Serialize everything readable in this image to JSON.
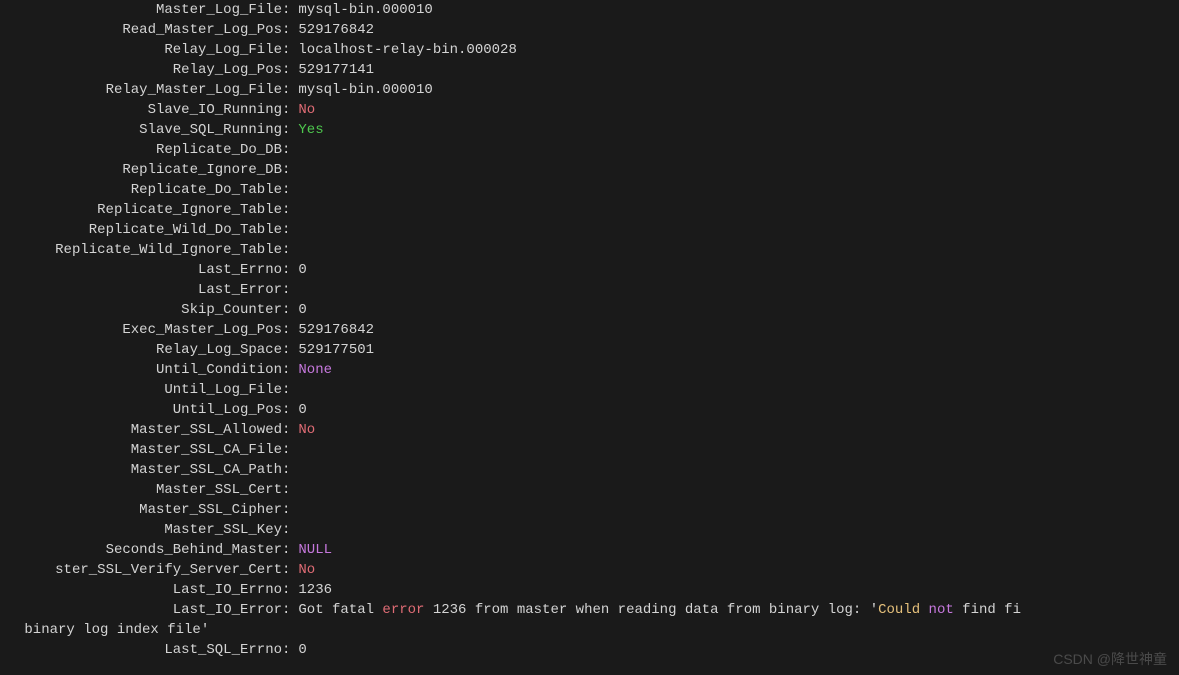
{
  "rows": [
    {
      "label": "Master_Log_File",
      "value": "mysql-bin.000010",
      "cls": ""
    },
    {
      "label": "Read_Master_Log_Pos",
      "value": "529176842",
      "cls": ""
    },
    {
      "label": "Relay_Log_File",
      "value": "localhost-relay-bin.000028",
      "cls": ""
    },
    {
      "label": "Relay_Log_Pos",
      "value": "529177141",
      "cls": ""
    },
    {
      "label": "Relay_Master_Log_File",
      "value": "mysql-bin.000010",
      "cls": ""
    },
    {
      "label": "Slave_IO_Running",
      "value": "No",
      "cls": "red"
    },
    {
      "label": "Slave_SQL_Running",
      "value": "Yes",
      "cls": "green"
    },
    {
      "label": "Replicate_Do_DB",
      "value": "",
      "cls": ""
    },
    {
      "label": "Replicate_Ignore_DB",
      "value": "",
      "cls": ""
    },
    {
      "label": "Replicate_Do_Table",
      "value": "",
      "cls": ""
    },
    {
      "label": "Replicate_Ignore_Table",
      "value": "",
      "cls": ""
    },
    {
      "label": "Replicate_Wild_Do_Table",
      "value": "",
      "cls": ""
    },
    {
      "label": "Replicate_Wild_Ignore_Table",
      "value": "",
      "cls": ""
    },
    {
      "label": "Last_Errno",
      "value": "0",
      "cls": ""
    },
    {
      "label": "Last_Error",
      "value": "",
      "cls": ""
    },
    {
      "label": "Skip_Counter",
      "value": "0",
      "cls": ""
    },
    {
      "label": "Exec_Master_Log_Pos",
      "value": "529176842",
      "cls": ""
    },
    {
      "label": "Relay_Log_Space",
      "value": "529177501",
      "cls": ""
    },
    {
      "label": "Until_Condition",
      "value": "None",
      "cls": "magenta"
    },
    {
      "label": "Until_Log_File",
      "value": "",
      "cls": ""
    },
    {
      "label": "Until_Log_Pos",
      "value": "0",
      "cls": ""
    },
    {
      "label": "Master_SSL_Allowed",
      "value": "No",
      "cls": "red"
    },
    {
      "label": "Master_SSL_CA_File",
      "value": "",
      "cls": ""
    },
    {
      "label": "Master_SSL_CA_Path",
      "value": "",
      "cls": ""
    },
    {
      "label": "Master_SSL_Cert",
      "value": "",
      "cls": ""
    },
    {
      "label": "Master_SSL_Cipher",
      "value": "",
      "cls": ""
    },
    {
      "label": "Master_SSL_Key",
      "value": "",
      "cls": ""
    },
    {
      "label": "Seconds_Behind_Master",
      "value": "NULL",
      "cls": "magenta"
    },
    {
      "label": "ster_SSL_Verify_Server_Cert",
      "value": "No",
      "cls": "red"
    },
    {
      "label": "Last_IO_Errno",
      "value": "1236",
      "cls": ""
    }
  ],
  "last_io_error": {
    "label": "Last_IO_Error",
    "p1": "Got fatal ",
    "p2_err": "error",
    "p3": " 1236 from master when reading data from binary log: '",
    "p4_could": "Could ",
    "p5_not": "not",
    "p6": " find fi",
    "cont": " binary log index file'"
  },
  "last_sql_errno": {
    "label": "Last_SQL_Errno",
    "value": "0"
  },
  "watermark": "CSDN @降世神童"
}
